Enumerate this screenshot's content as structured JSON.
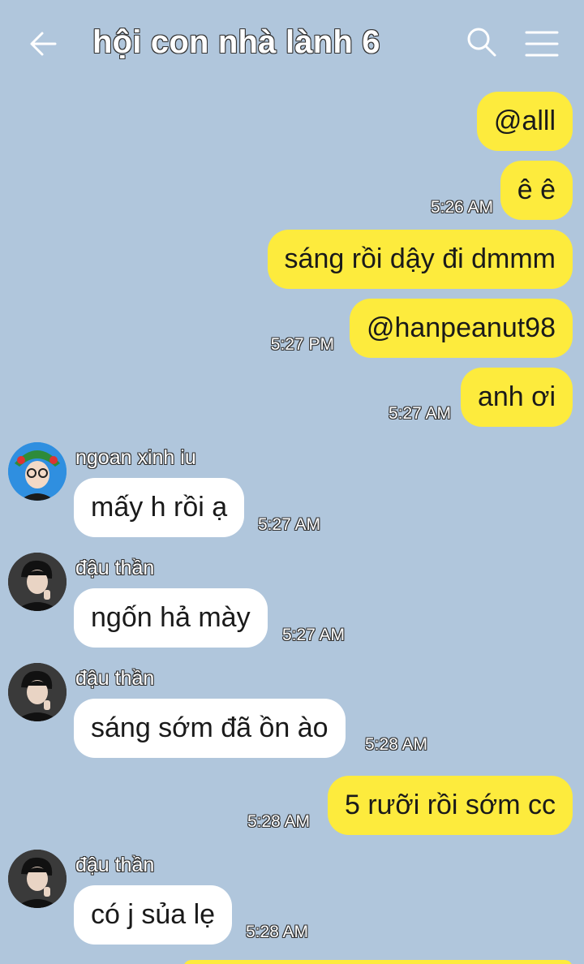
{
  "header": {
    "title": "hội con nhà lành 6",
    "back_icon": "arrow-left-icon",
    "search_icon": "search-icon",
    "menu_icon": "hamburger-menu-icon"
  },
  "colors": {
    "background": "#b0c6dc",
    "outgoing_bubble": "#fdeb3d",
    "incoming_bubble": "#ffffff"
  },
  "messages": [
    {
      "direction": "outgoing",
      "text": "@alll",
      "time": ""
    },
    {
      "direction": "outgoing",
      "text": "ê ê",
      "time": "5:26 AM"
    },
    {
      "direction": "outgoing",
      "text": "sáng rồi dậy đi dmmm",
      "time": ""
    },
    {
      "direction": "outgoing",
      "text": "@hanpeanut98",
      "time": "5:27 PM"
    },
    {
      "direction": "outgoing",
      "text": "anh ơi",
      "time": "5:27 AM"
    },
    {
      "direction": "incoming",
      "sender": "ngoan xinh iu",
      "text": "mấy h rồi ạ",
      "time": "5:27 AM"
    },
    {
      "direction": "incoming",
      "sender": "đậu thần",
      "text": "ngốn hả mày",
      "time": "5:27 AM"
    },
    {
      "direction": "incoming",
      "sender": "đậu thần",
      "text": "sáng sớm đã ồn ào",
      "time": "5:28 AM"
    },
    {
      "direction": "outgoing",
      "text": "5 rưỡi rồi sớm cc",
      "time": "5:28 AM"
    },
    {
      "direction": "incoming",
      "sender": "đậu thần",
      "text": "có j sủa lẹ",
      "time": "5:28 AM"
    }
  ]
}
